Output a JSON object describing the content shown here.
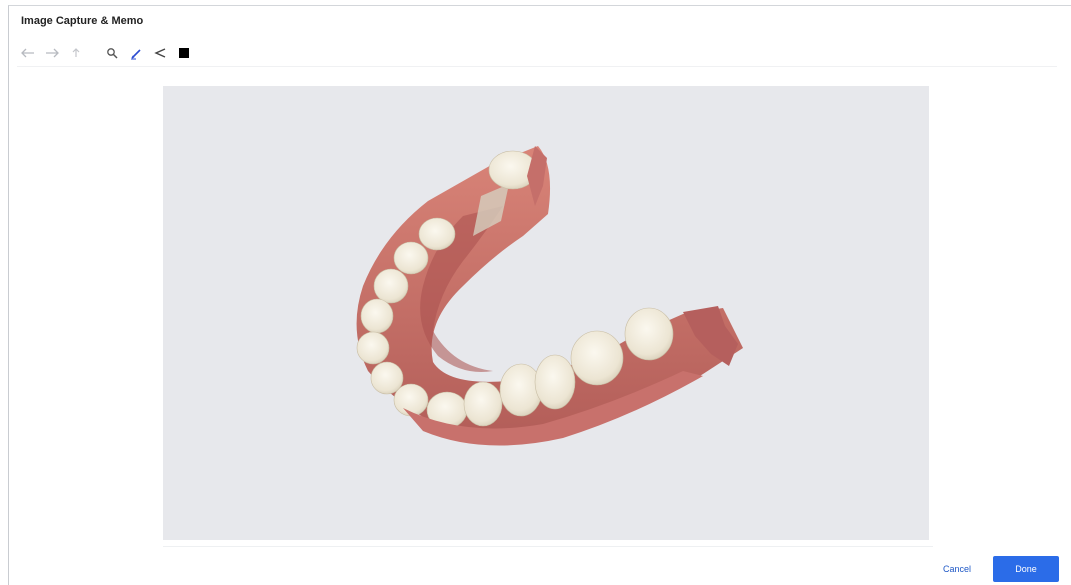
{
  "window": {
    "title": "Image Capture & Memo"
  },
  "toolbar": {
    "tools": [
      {
        "name": "undo-icon",
        "enabled": false
      },
      {
        "name": "redo-icon",
        "enabled": false
      },
      {
        "name": "reset-icon",
        "enabled": false
      },
      {
        "name": "magnify-icon",
        "enabled": true
      },
      {
        "name": "pen-icon",
        "enabled": true
      },
      {
        "name": "line-icon",
        "enabled": true
      },
      {
        "name": "color-swatch-icon",
        "enabled": true
      }
    ],
    "pen_color": "#2b4bd1",
    "swatch_color": "#000000"
  },
  "canvas": {
    "background": "#e7e8ec"
  },
  "footer": {
    "cancel_label": "Cancel",
    "done_label": "Done"
  },
  "colors": {
    "accent": "#2b6ce8",
    "gum": "#c9736a",
    "tooth": "#efeadb"
  }
}
